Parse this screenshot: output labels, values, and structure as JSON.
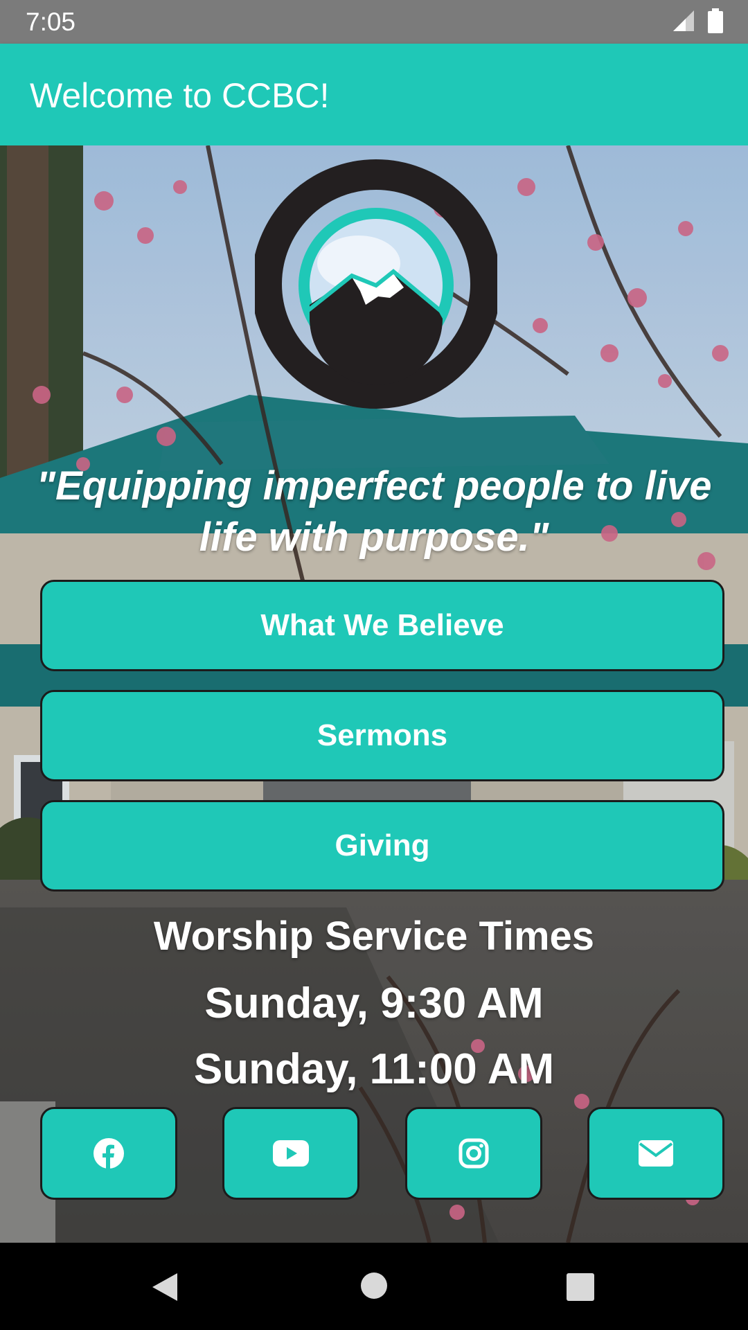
{
  "status_bar": {
    "time": "7:05",
    "icons": [
      "signal-icon",
      "battery-icon"
    ]
  },
  "app_bar": {
    "title": "Welcome to CCBC!"
  },
  "tagline": "\"Equipping imperfect people to live life with purpose.\"",
  "buttons": [
    {
      "label": "What We Believe"
    },
    {
      "label": "Sermons"
    },
    {
      "label": "Giving"
    }
  ],
  "worship": {
    "heading": "Worship Service Times",
    "times": [
      "Sunday, 9:30 AM",
      "Sunday, 11:00 AM"
    ]
  },
  "social": [
    "facebook-icon",
    "youtube-icon",
    "instagram-icon",
    "email-icon"
  ],
  "colors": {
    "accent": "#1fc8b7",
    "status_bar": "#7b7b7b",
    "nav_bar": "#000000"
  }
}
